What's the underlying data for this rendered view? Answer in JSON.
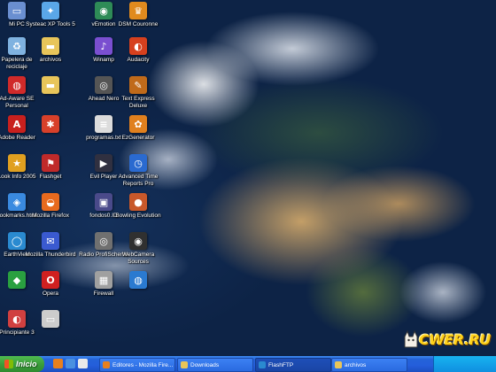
{
  "desktop": {
    "icons": [
      {
        "label": "Mi PC",
        "color": "#6a8fd0",
        "glyph": "▭"
      },
      {
        "label": "Systeac XP Tools 5",
        "color": "#5aa7e8",
        "glyph": "✦"
      },
      {
        "label": "vEmotion",
        "color": "#2e8b57",
        "glyph": "◉"
      },
      {
        "label": "DSM Couronne",
        "color": "#e08a1e",
        "glyph": "♛"
      },
      {
        "label": "Papelera de reciclaje",
        "color": "#7fb2e0",
        "glyph": "♻"
      },
      {
        "label": "archivos",
        "color": "#e8c55a",
        "glyph": "▬"
      },
      {
        "label": "Winamp",
        "color": "#7a4fd0",
        "glyph": "♪"
      },
      {
        "label": "Audacity",
        "color": "#d6401e",
        "glyph": "◐"
      },
      {
        "label": "Ad-Aware SE Personal",
        "color": "#d02a2a",
        "glyph": "◍"
      },
      {
        "label": "",
        "color": "#e8c55a",
        "glyph": "▬"
      },
      {
        "label": "Ahead Nero",
        "color": "#555555",
        "glyph": "◎"
      },
      {
        "label": "Text Express Deluxe",
        "color": "#c06a1a",
        "glyph": "✎"
      },
      {
        "label": "Adobe Reader",
        "color": "#c8201e",
        "glyph": "A"
      },
      {
        "label": "",
        "color": "#d8402a",
        "glyph": "✱"
      },
      {
        "label": "programas.txt",
        "color": "#dcdcdc",
        "glyph": "≡"
      },
      {
        "label": "EzGenerator",
        "color": "#e0801e",
        "glyph": "✿"
      },
      {
        "label": "Look Info 2005",
        "color": "#e0a020",
        "glyph": "★"
      },
      {
        "label": "Flashget",
        "color": "#c02a2a",
        "glyph": "⚑"
      },
      {
        "label": "Evil Player",
        "color": "#303040",
        "glyph": "▶"
      },
      {
        "label": "Advanced Time Reports Pro",
        "color": "#2a6ad0",
        "glyph": "◷"
      },
      {
        "label": "bookmarks.html",
        "color": "#3a8ae0",
        "glyph": "◈"
      },
      {
        "label": "Mozilla Firefox",
        "color": "#e86a1e",
        "glyph": "◒"
      },
      {
        "label": "fondos0.ID",
        "color": "#4a4a8a",
        "glyph": "▣"
      },
      {
        "label": "Bowling Evolution",
        "color": "#c8582a",
        "glyph": "●"
      },
      {
        "label": "EarthView",
        "color": "#2a8ad0",
        "glyph": "◯"
      },
      {
        "label": "Mozilla Thunderbird",
        "color": "#3a5ad0",
        "glyph": "✉"
      },
      {
        "label": "Radio ProfiSchems",
        "color": "#707070",
        "glyph": "◎"
      },
      {
        "label": "WebCamera Sources",
        "color": "#303030",
        "glyph": "◉"
      },
      {
        "label": "",
        "color": "#2aa040",
        "glyph": "◆"
      },
      {
        "label": "Opera",
        "color": "#d02020",
        "glyph": "O"
      },
      {
        "label": "Firewall",
        "color": "#a0a0a0",
        "glyph": "▦"
      },
      {
        "label": "",
        "color": "#2a7ad0",
        "glyph": "◍"
      },
      {
        "label": "Principiante 3",
        "color": "#d04040",
        "glyph": "◐"
      },
      {
        "label": "",
        "color": "#cccccc",
        "glyph": "▭"
      }
    ]
  },
  "taskbar": {
    "start_label": "Inicio",
    "quick_launch": [
      {
        "name": "firefox-quicklaunch-icon",
        "color": "#e8801e"
      },
      {
        "name": "outlook-quicklaunch-icon",
        "color": "#4a90e0"
      },
      {
        "name": "desktop-quicklaunch-icon",
        "color": "#eaeaea"
      }
    ],
    "tasks": [
      {
        "label": "Editores - Mozilla Fire...",
        "icon_color": "#e8801e",
        "active": false
      },
      {
        "label": "Downloads",
        "icon_color": "#e8c55a",
        "active": false
      },
      {
        "label": "FlashFTP",
        "icon_color": "#2a8ad0",
        "active": true
      },
      {
        "label": "archivos",
        "icon_color": "#e8c55a",
        "active": false
      }
    ],
    "clock": "",
    "tray_color": "#18b2f0"
  },
  "watermark": {
    "text": "CWER.RU"
  }
}
